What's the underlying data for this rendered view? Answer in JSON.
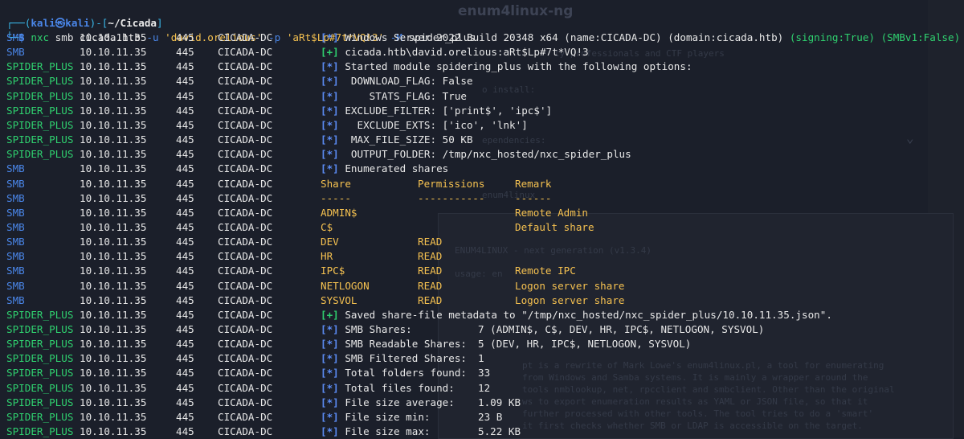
{
  "background_window": {
    "title": "enum4linux-ng",
    "text_lines": [
      "ty professionals and CTF players",
      "o install: ",
      "ependencies:",
      "enum4linux",
      "ENUM4LINUX - next generation (v1.3.4)",
      "usage: en",
      "pt is a rewrite of Mark Lowe's enum4linux.pl, a tool for enumerating",
      "from Windows and Samba systems. It is mainly a wrapper around the",
      "tools nmblookup, net, rpcclient and smbclient. Other than the original",
      "ws to export enumeration results as YAML or JSON file, so that it",
      "further processed with other tools. The tool tries to do a 'smart'",
      "it first checks whether SMB or LDAP is accessible on the target."
    ]
  },
  "prompt": {
    "open": "┌──(",
    "user": "kali㉿kali",
    "mid": ")-[",
    "path": "~/Cicada",
    "close": "]",
    "line2_prefix": "└─",
    "dollar": "$ ",
    "command": {
      "bin": "nxc",
      "args1": " smb cicada.htb ",
      "flag_u": "-u",
      "user": " 'david.orelious' ",
      "flag_p": "-p",
      "password": " 'aRt$Lp#7t*VQ!3' ",
      "flag_m": "-M",
      "module": " spider_plus"
    }
  },
  "rows": [
    {
      "mod": "SMB",
      "ip": "10.10.11.35",
      "port": "445",
      "host": "CICADA-DC",
      "tag": "[*]",
      "tag_color": "blue",
      "msg": "Windows Server 2022 Build 20348 x64 (name:CICADA-DC) (domain:cicada.htb) ",
      "extra1": "(signing:True)",
      "extra2": " (SMBv1:False)"
    },
    {
      "mod": "SMB",
      "ip": "10.10.11.35",
      "port": "445",
      "host": "CICADA-DC",
      "tag": "[+]",
      "tag_color": "green",
      "msg": "cicada.htb\\david.orelious:aRt$Lp#7t*VQ!3"
    },
    {
      "mod": "SPIDER_PLUS",
      "ip": "10.10.11.35",
      "port": "445",
      "host": "CICADA-DC",
      "tag": "[*]",
      "tag_color": "blue",
      "msg": "Started module spidering_plus with the following options:"
    },
    {
      "mod": "SPIDER_PLUS",
      "ip": "10.10.11.35",
      "port": "445",
      "host": "CICADA-DC",
      "tag": "[*]",
      "tag_color": "blue",
      "msg": " DOWNLOAD_FLAG: False"
    },
    {
      "mod": "SPIDER_PLUS",
      "ip": "10.10.11.35",
      "port": "445",
      "host": "CICADA-DC",
      "tag": "[*]",
      "tag_color": "blue",
      "msg": "    STATS_FLAG: True"
    },
    {
      "mod": "SPIDER_PLUS",
      "ip": "10.10.11.35",
      "port": "445",
      "host": "CICADA-DC",
      "tag": "[*]",
      "tag_color": "blue",
      "msg": "EXCLUDE_FILTER: ['print$', 'ipc$']"
    },
    {
      "mod": "SPIDER_PLUS",
      "ip": "10.10.11.35",
      "port": "445",
      "host": "CICADA-DC",
      "tag": "[*]",
      "tag_color": "blue",
      "msg": "  EXCLUDE_EXTS: ['ico', 'lnk']"
    },
    {
      "mod": "SPIDER_PLUS",
      "ip": "10.10.11.35",
      "port": "445",
      "host": "CICADA-DC",
      "tag": "[*]",
      "tag_color": "blue",
      "msg": " MAX_FILE_SIZE: 50 KB"
    },
    {
      "mod": "SPIDER_PLUS",
      "ip": "10.10.11.35",
      "port": "445",
      "host": "CICADA-DC",
      "tag": "[*]",
      "tag_color": "blue",
      "msg": " OUTPUT_FOLDER: /tmp/nxc_hosted/nxc_spider_plus"
    },
    {
      "mod": "SMB",
      "ip": "10.10.11.35",
      "port": "445",
      "host": "CICADA-DC",
      "tag": "[*]",
      "tag_color": "blue",
      "msg": "Enumerated shares"
    },
    {
      "mod": "SMB",
      "ip": "10.10.11.35",
      "port": "445",
      "host": "CICADA-DC",
      "share": "Share",
      "perm": "Permissions",
      "remark": "Remark"
    },
    {
      "mod": "SMB",
      "ip": "10.10.11.35",
      "port": "445",
      "host": "CICADA-DC",
      "share": "-----",
      "perm": "-----------",
      "remark": "------"
    },
    {
      "mod": "SMB",
      "ip": "10.10.11.35",
      "port": "445",
      "host": "CICADA-DC",
      "share": "ADMIN$",
      "perm": "",
      "remark": "Remote Admin"
    },
    {
      "mod": "SMB",
      "ip": "10.10.11.35",
      "port": "445",
      "host": "CICADA-DC",
      "share": "C$",
      "perm": "",
      "remark": "Default share"
    },
    {
      "mod": "SMB",
      "ip": "10.10.11.35",
      "port": "445",
      "host": "CICADA-DC",
      "share": "DEV",
      "perm": "READ",
      "remark": ""
    },
    {
      "mod": "SMB",
      "ip": "10.10.11.35",
      "port": "445",
      "host": "CICADA-DC",
      "share": "HR",
      "perm": "READ",
      "remark": ""
    },
    {
      "mod": "SMB",
      "ip": "10.10.11.35",
      "port": "445",
      "host": "CICADA-DC",
      "share": "IPC$",
      "perm": "READ",
      "remark": "Remote IPC"
    },
    {
      "mod": "SMB",
      "ip": "10.10.11.35",
      "port": "445",
      "host": "CICADA-DC",
      "share": "NETLOGON",
      "perm": "READ",
      "remark": "Logon server share"
    },
    {
      "mod": "SMB",
      "ip": "10.10.11.35",
      "port": "445",
      "host": "CICADA-DC",
      "share": "SYSVOL",
      "perm": "READ",
      "remark": "Logon server share"
    },
    {
      "mod": "SPIDER_PLUS",
      "ip": "10.10.11.35",
      "port": "445",
      "host": "CICADA-DC",
      "tag": "[+]",
      "tag_color": "green",
      "msg": "Saved share-file metadata to \"/tmp/nxc_hosted/nxc_spider_plus/10.10.11.35.json\"."
    },
    {
      "mod": "SPIDER_PLUS",
      "ip": "10.10.11.35",
      "port": "445",
      "host": "CICADA-DC",
      "tag": "[*]",
      "tag_color": "blue",
      "msg": "SMB Shares:",
      "value": "7 (ADMIN$, C$, DEV, HR, IPC$, NETLOGON, SYSVOL)"
    },
    {
      "mod": "SPIDER_PLUS",
      "ip": "10.10.11.35",
      "port": "445",
      "host": "CICADA-DC",
      "tag": "[*]",
      "tag_color": "blue",
      "msg": "SMB Readable Shares:",
      "value": "5 (DEV, HR, IPC$, NETLOGON, SYSVOL)"
    },
    {
      "mod": "SPIDER_PLUS",
      "ip": "10.10.11.35",
      "port": "445",
      "host": "CICADA-DC",
      "tag": "[*]",
      "tag_color": "blue",
      "msg": "SMB Filtered Shares:",
      "value": "1"
    },
    {
      "mod": "SPIDER_PLUS",
      "ip": "10.10.11.35",
      "port": "445",
      "host": "CICADA-DC",
      "tag": "[*]",
      "tag_color": "blue",
      "msg": "Total folders found:",
      "value": "33"
    },
    {
      "mod": "SPIDER_PLUS",
      "ip": "10.10.11.35",
      "port": "445",
      "host": "CICADA-DC",
      "tag": "[*]",
      "tag_color": "blue",
      "msg": "Total files found:",
      "value": "12"
    },
    {
      "mod": "SPIDER_PLUS",
      "ip": "10.10.11.35",
      "port": "445",
      "host": "CICADA-DC",
      "tag": "[*]",
      "tag_color": "blue",
      "msg": "File size average:",
      "value": "1.09 KB"
    },
    {
      "mod": "SPIDER_PLUS",
      "ip": "10.10.11.35",
      "port": "445",
      "host": "CICADA-DC",
      "tag": "[*]",
      "tag_color": "blue",
      "msg": "File size min:",
      "value": "23 B"
    },
    {
      "mod": "SPIDER_PLUS",
      "ip": "10.10.11.35",
      "port": "445",
      "host": "CICADA-DC",
      "tag": "[*]",
      "tag_color": "blue",
      "msg": "File size max:",
      "value": "5.22 KB"
    }
  ]
}
